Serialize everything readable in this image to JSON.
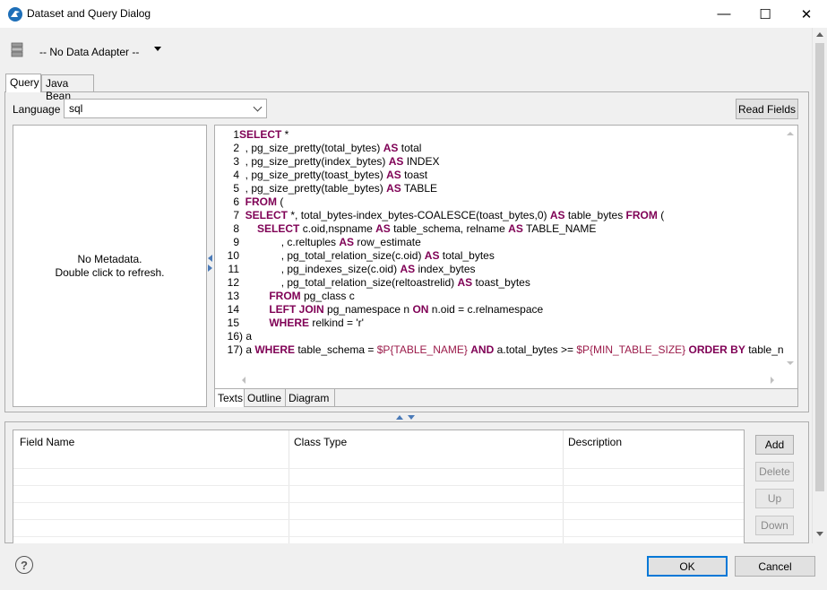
{
  "window": {
    "title": "Dataset and Query Dialog",
    "minimize_glyph": "—",
    "maximize_glyph": "☐",
    "close_glyph": "✕"
  },
  "toolbar": {
    "data_adapter": "-- No Data Adapter --"
  },
  "tabs": [
    "Query",
    "Java Bean"
  ],
  "query": {
    "language_label": "Language",
    "language_value": "sql",
    "read_fields_label": "Read Fields"
  },
  "metadata": {
    "line1": "No Metadata.",
    "line2": "Double click to refresh."
  },
  "editor": {
    "lines": [
      {
        "n": "1",
        "indent": "",
        "tokens": [
          {
            "t": "SELECT",
            "c": "kw"
          },
          {
            "t": " *"
          }
        ]
      },
      {
        "n": "2",
        "indent": "  ",
        "tokens": [
          {
            "t": ", pg_size_pretty(total_bytes) "
          },
          {
            "t": "AS",
            "c": "kw"
          },
          {
            "t": " total"
          }
        ]
      },
      {
        "n": "3",
        "indent": "  ",
        "tokens": [
          {
            "t": ", pg_size_pretty(index_bytes) "
          },
          {
            "t": "AS",
            "c": "kw"
          },
          {
            "t": " INDEX"
          }
        ]
      },
      {
        "n": "4",
        "indent": "  ",
        "tokens": [
          {
            "t": ", pg_size_pretty(toast_bytes) "
          },
          {
            "t": "AS",
            "c": "kw"
          },
          {
            "t": " toast"
          }
        ]
      },
      {
        "n": "5",
        "indent": "  ",
        "tokens": [
          {
            "t": ", pg_size_pretty(table_bytes) "
          },
          {
            "t": "AS",
            "c": "kw"
          },
          {
            "t": " TABLE"
          }
        ]
      },
      {
        "n": "6",
        "indent": "  ",
        "tokens": [
          {
            "t": "FROM",
            "c": "kw"
          },
          {
            "t": " ("
          }
        ]
      },
      {
        "n": "7",
        "indent": "  ",
        "tokens": [
          {
            "t": "SELECT",
            "c": "kw"
          },
          {
            "t": " *, total_bytes-index_bytes-COALESCE(toast_bytes,0) "
          },
          {
            "t": "AS",
            "c": "kw"
          },
          {
            "t": " table_bytes "
          },
          {
            "t": "FROM",
            "c": "kw"
          },
          {
            "t": " ("
          }
        ]
      },
      {
        "n": "8",
        "indent": "      ",
        "tokens": [
          {
            "t": "SELECT",
            "c": "kw"
          },
          {
            "t": " c.oid,nspname "
          },
          {
            "t": "AS",
            "c": "kw"
          },
          {
            "t": " table_schema, relname "
          },
          {
            "t": "AS",
            "c": "kw"
          },
          {
            "t": " TABLE_NAME"
          }
        ]
      },
      {
        "n": "9",
        "indent": "              ",
        "tokens": [
          {
            "t": ", c.reltuples "
          },
          {
            "t": "AS",
            "c": "kw"
          },
          {
            "t": " row_estimate"
          }
        ]
      },
      {
        "n": "10",
        "indent": "              ",
        "tokens": [
          {
            "t": ", pg_total_relation_size(c.oid) "
          },
          {
            "t": "AS",
            "c": "kw"
          },
          {
            "t": " total_bytes"
          }
        ]
      },
      {
        "n": "11",
        "indent": "              ",
        "tokens": [
          {
            "t": ", pg_indexes_size(c.oid) "
          },
          {
            "t": "AS",
            "c": "kw"
          },
          {
            "t": " index_bytes"
          }
        ]
      },
      {
        "n": "12",
        "indent": "              ",
        "tokens": [
          {
            "t": ", pg_total_relation_size(reltoastrelid) "
          },
          {
            "t": "AS",
            "c": "kw"
          },
          {
            "t": " toast_bytes"
          }
        ]
      },
      {
        "n": "13",
        "indent": "          ",
        "tokens": [
          {
            "t": "FROM",
            "c": "kw"
          },
          {
            "t": " pg_class c"
          }
        ]
      },
      {
        "n": "14",
        "indent": "          ",
        "tokens": [
          {
            "t": "LEFT JOIN",
            "c": "kw"
          },
          {
            "t": " pg_namespace n "
          },
          {
            "t": "ON",
            "c": "kw"
          },
          {
            "t": " n.oid = c.relnamespace"
          }
        ]
      },
      {
        "n": "15",
        "indent": "          ",
        "tokens": [
          {
            "t": "WHERE",
            "c": "kw"
          },
          {
            "t": " relkind = 'r'"
          }
        ]
      },
      {
        "n": "16",
        "indent": "",
        "tokens": [
          {
            "t": ") a"
          }
        ]
      },
      {
        "n": "17",
        "indent": "",
        "tokens": [
          {
            "t": ") a "
          },
          {
            "t": "WHERE",
            "c": "kw"
          },
          {
            "t": " table_schema = "
          },
          {
            "t": "$P{TABLE_NAME}",
            "c": "vr"
          },
          {
            "t": " "
          },
          {
            "t": "AND",
            "c": "kw"
          },
          {
            "t": " a.total_bytes >= "
          },
          {
            "t": "$P{MIN_TABLE_SIZE}",
            "c": "vr"
          },
          {
            "t": " "
          },
          {
            "t": "ORDER BY",
            "c": "kw"
          },
          {
            "t": " table_name"
          }
        ]
      }
    ],
    "tabs": [
      "Texts",
      "Outline",
      "Diagram"
    ]
  },
  "fields": {
    "columns": [
      "Field Name",
      "Class Type",
      "Description"
    ],
    "buttons": {
      "add": "Add",
      "delete": "Delete",
      "up": "Up",
      "down": "Down"
    }
  },
  "footer": {
    "help": "?",
    "ok": "OK",
    "cancel": "Cancel"
  },
  "colors": {
    "keyword": "#7f0055",
    "parameter": "#9b1b4a",
    "accent": "#0078d7"
  }
}
